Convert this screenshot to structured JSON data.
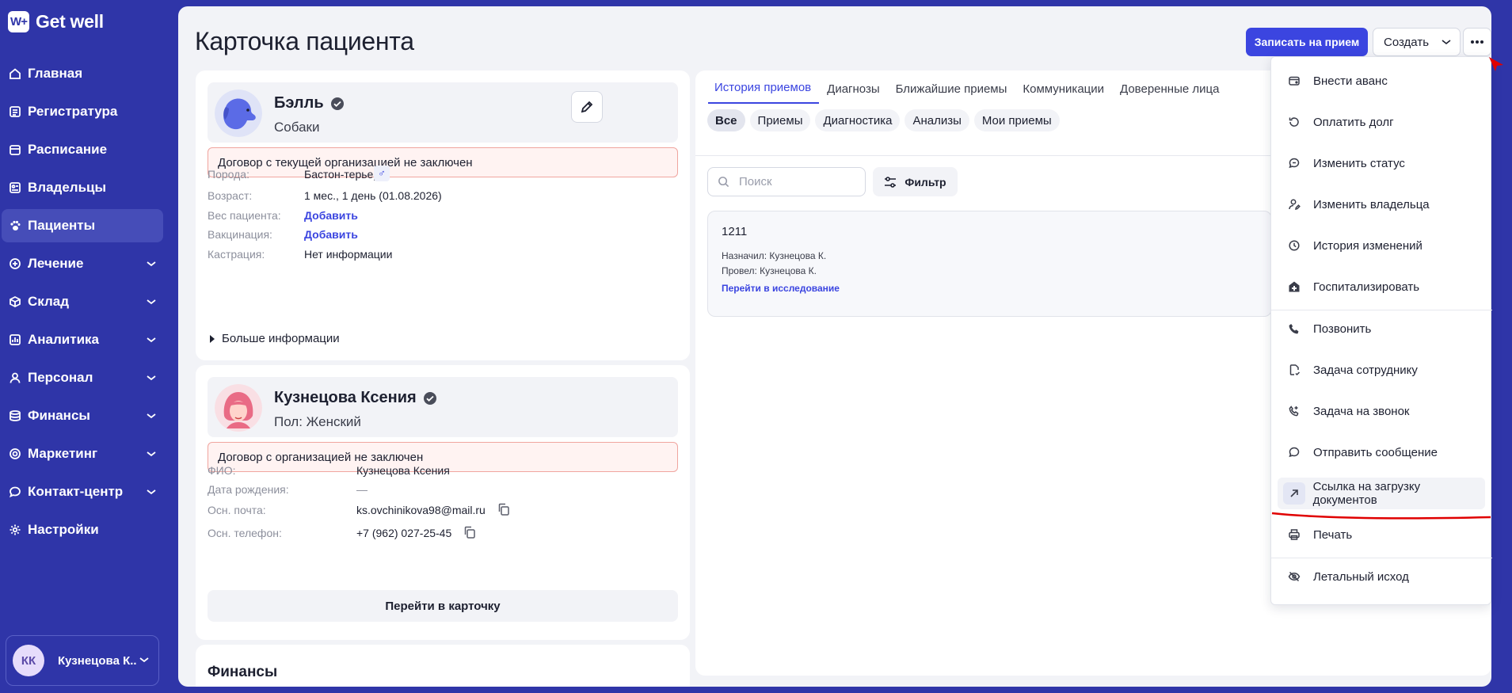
{
  "app": {
    "logo_mark": "W+",
    "name": "Get well"
  },
  "sidebar": {
    "items": [
      {
        "label": "Главная",
        "icon": "home-icon"
      },
      {
        "label": "Регистратура",
        "icon": "registry-icon"
      },
      {
        "label": "Расписание",
        "icon": "calendar-icon"
      },
      {
        "label": "Владельцы",
        "icon": "owners-icon"
      },
      {
        "label": "Пациенты",
        "icon": "paw-icon",
        "active": true
      },
      {
        "label": "Лечение",
        "icon": "plus-circle-icon",
        "expandable": true
      },
      {
        "label": "Склад",
        "icon": "box-icon",
        "expandable": true
      },
      {
        "label": "Аналитика",
        "icon": "chart-icon",
        "expandable": true
      },
      {
        "label": "Персонал",
        "icon": "person-icon",
        "expandable": true
      },
      {
        "label": "Финансы",
        "icon": "database-icon",
        "expandable": true
      },
      {
        "label": "Маркетинг",
        "icon": "target-icon",
        "expandable": true
      },
      {
        "label": "Контакт-центр",
        "icon": "chat-icon",
        "expandable": true
      },
      {
        "label": "Настройки",
        "icon": "gear-icon"
      }
    ],
    "user": {
      "initials": "КК",
      "name": "Кузнецова К..."
    }
  },
  "header": {
    "title": "Карточка пациента",
    "book_button": "Записать на прием",
    "create_button": "Создать"
  },
  "patient": {
    "name": "Бэлль",
    "species": "Собаки",
    "alert": "Договор с текущей организацией не заключен",
    "fields": [
      {
        "label": "Порода:",
        "value": "Бастон-терьер"
      },
      {
        "label": "Возраст:",
        "value": "1 мес., 1 день (01.08.2026)"
      },
      {
        "label": "Вес пациента:",
        "value": "Добавить",
        "link": true
      },
      {
        "label": "Вакцинация:",
        "value": "Добавить",
        "link": true
      },
      {
        "label": "Кастрация:",
        "value": "Нет информации"
      }
    ],
    "more_info": "Больше информации",
    "sex_symbol": "♂"
  },
  "owner": {
    "name": "Кузнецова Ксения",
    "gender": "Пол: Женский",
    "alert": "Договор с организацией не заключен",
    "fields": [
      {
        "label": "ФИО:",
        "value": "Кузнецова Ксения"
      },
      {
        "label": "Дата рождения:",
        "value": "—"
      },
      {
        "label": "Осн. почта:",
        "value": "ks.ovchinikova98@mail.ru"
      },
      {
        "label": "Осн. телефон:",
        "value": "+7 (962) 027-25-45"
      }
    ],
    "goto_button": "Перейти в карточку"
  },
  "finance": {
    "title": "Финансы"
  },
  "history": {
    "tabs": [
      "История приемов",
      "Диагнозы",
      "Ближайшие приемы",
      "Коммуникации",
      "Доверенные лица"
    ],
    "chips": [
      "Все",
      "Приемы",
      "Диагностика",
      "Анализы",
      "Мои приемы"
    ],
    "search_placeholder": "Поиск",
    "filter_button": "Фильтр",
    "visit": {
      "number": "1211",
      "assigned": "Назначил: Кузнецова К.",
      "performed": "Провел: Кузнецова К.",
      "link": "Перейти в исследование"
    }
  },
  "menu": {
    "items": [
      {
        "label": "Внести аванс",
        "icon": "wallet-icon"
      },
      {
        "label": "Оплатить долг",
        "icon": "refresh-icon"
      },
      {
        "label": "Изменить статус",
        "icon": "status-icon"
      },
      {
        "label": "Изменить владельца",
        "icon": "user-edit-icon"
      },
      {
        "label": "История изменений",
        "icon": "clock-icon"
      },
      {
        "label": "Госпитализировать",
        "icon": "hospital-icon"
      },
      {
        "label": "Позвонить",
        "icon": "phone-icon"
      },
      {
        "label": "Задача сотруднику",
        "icon": "task-icon"
      },
      {
        "label": "Задача на звонок",
        "icon": "phone-task-icon"
      },
      {
        "label": "Отправить сообщение",
        "icon": "message-icon"
      },
      {
        "label": "Ссылка на загрузку документов",
        "icon": "arrow-up-right-icon",
        "highlighted": true
      },
      {
        "label": "Печать",
        "icon": "printer-icon"
      },
      {
        "label": "Летальный исход",
        "icon": "eye-off-icon"
      }
    ]
  },
  "colors": {
    "primary": "#3b45e0",
    "sidebar": "#2f35a8",
    "annotation": "#e00000"
  }
}
